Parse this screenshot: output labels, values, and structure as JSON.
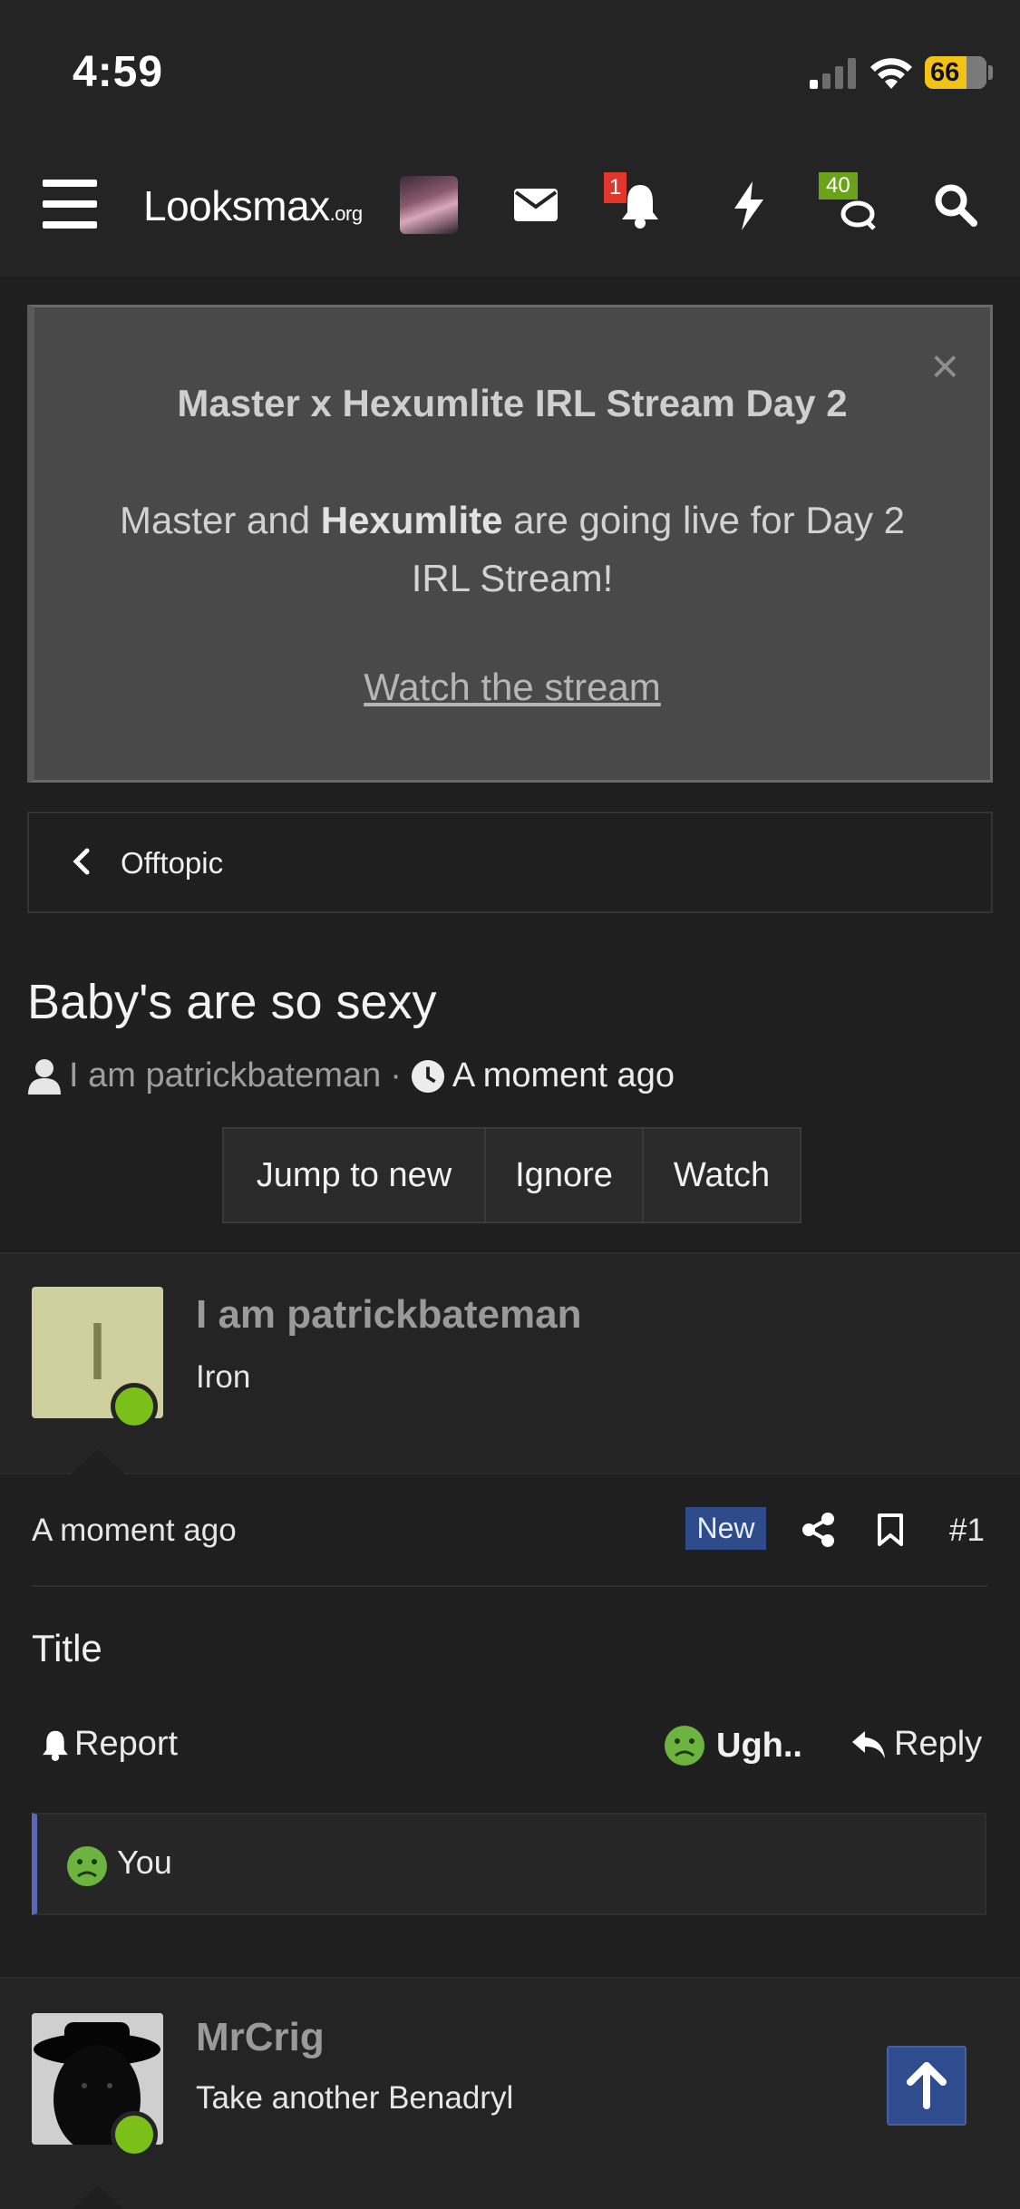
{
  "status_bar": {
    "time": "4:59",
    "battery_level": "66"
  },
  "nav": {
    "logo_main": "Looksmax",
    "logo_suffix": ".org",
    "notifications_count": "1",
    "conversations_count": "40"
  },
  "notice": {
    "title": "Master x Hexumlite IRL Stream Day 2",
    "body_pre": "Master and ",
    "body_bold": "Hexumlite",
    "body_post": " are going live for Day 2 IRL Stream!",
    "link": "Watch the stream",
    "close": "×"
  },
  "breadcrumb": {
    "label": "Offtopic"
  },
  "thread": {
    "title": "Baby's are so sexy",
    "author": "I am patrickbateman",
    "separator": "·",
    "time": "A moment ago",
    "buttons": {
      "jump": "Jump to new",
      "ignore": "Ignore",
      "watch": "Watch"
    }
  },
  "post1": {
    "avatar_letter": "I",
    "username": "I am patrickbateman",
    "user_title": "Iron",
    "time": "A moment ago",
    "new_badge": "New",
    "number": "#1",
    "content": "Title",
    "report": "Report",
    "reaction": "Ugh..",
    "reply": "Reply",
    "reacted_by": "You"
  },
  "post2": {
    "username": "MrCrig",
    "user_title": "Take another Benadryl"
  },
  "colors": {
    "accent_blue": "#2e4c8c",
    "online_green": "#7bbf19",
    "alert_red": "#e0362c",
    "quote_bar": "#5c67b8"
  }
}
